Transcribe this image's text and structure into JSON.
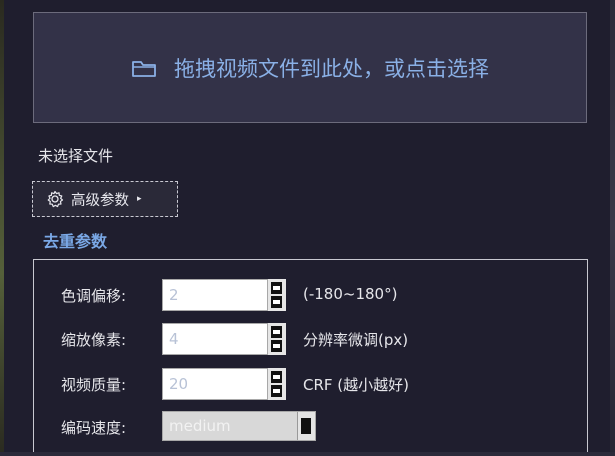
{
  "dropzone": {
    "icon": "folder-icon",
    "text": "拖拽视频文件到此处，或点击选择"
  },
  "status": "未选择文件",
  "advanced_button": {
    "icon": "gear-icon",
    "label": "高级参数",
    "arrow": "▸"
  },
  "section_title": "去重参数",
  "params": {
    "hue": {
      "label": "色调偏移:",
      "value": "2",
      "hint": "(-180~180°)"
    },
    "scale": {
      "label": "缩放像素:",
      "value": "4",
      "hint": "分辨率微调(px)"
    },
    "quality": {
      "label": "视频质量:",
      "value": "20",
      "hint": "CRF (越小越好)"
    },
    "speed": {
      "label": "编码速度:",
      "value": "medium"
    }
  },
  "colors": {
    "background": "#1f1e2e",
    "accent": "#7aa8e6",
    "dropzone_bg": "#333248"
  }
}
